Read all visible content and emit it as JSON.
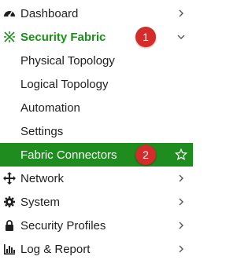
{
  "colors": {
    "accent_green": "#1a8f1a",
    "selected_bg": "#1e8c1e",
    "badge_red": "#d42b2b",
    "text": "#1f1f1f"
  },
  "menu": {
    "dashboard": {
      "label": "Dashboard",
      "icon": "dashboard-icon"
    },
    "security_fabric": {
      "label": "Security Fabric",
      "icon": "security-fabric-icon",
      "badge": "1",
      "children": {
        "physical_topology": "Physical Topology",
        "logical_topology": "Logical Topology",
        "automation": "Automation",
        "settings": "Settings",
        "fabric_connectors": {
          "label": "Fabric Connectors",
          "badge": "2",
          "icon": "star-outline-icon"
        }
      }
    },
    "network": {
      "label": "Network",
      "icon": "move-arrows-icon"
    },
    "system": {
      "label": "System",
      "icon": "gear-icon"
    },
    "security_profiles": {
      "label": "Security Profiles",
      "icon": "lock-icon"
    },
    "log_report": {
      "label": "Log & Report",
      "icon": "bar-chart-icon"
    }
  }
}
